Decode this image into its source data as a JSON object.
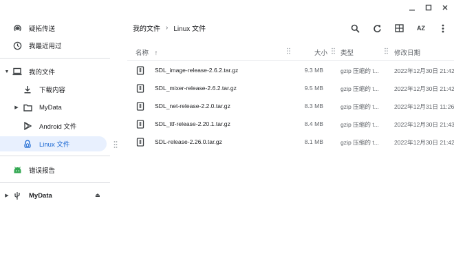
{
  "window": {
    "minimize_icon": "minimize-icon",
    "maximize_icon": "maximize-icon",
    "close_icon": "close-icon"
  },
  "sidebar": {
    "items": [
      {
        "label": "疑拓传送",
        "icon": "nearby-share-icon"
      },
      {
        "label": "我最近用过",
        "icon": "recent-clock-icon"
      },
      {
        "label": "我的文件",
        "icon": "laptop-icon",
        "expanded": true
      },
      {
        "label": "下载内容",
        "icon": "download-icon"
      },
      {
        "label": "MyData",
        "icon": "folder-icon"
      },
      {
        "label": "Android 文件",
        "icon": "play-store-icon"
      },
      {
        "label": "Linux 文件",
        "icon": "linux-penguin-icon",
        "selected": true
      },
      {
        "label": "错误报告",
        "icon": "android-icon"
      },
      {
        "label": "MyData",
        "icon": "usb-icon"
      }
    ]
  },
  "breadcrumb": {
    "root": "我的文件",
    "current": "Linux 文件"
  },
  "toolbar": {
    "icons": [
      "search-icon",
      "refresh-icon",
      "grid-view-icon",
      "sort-az-icon",
      "more-vert-icon"
    ],
    "sort_label": "AZ"
  },
  "columns": {
    "name": "名称",
    "size": "大小",
    "type": "类型",
    "modified": "修改日期"
  },
  "files": [
    {
      "name": "SDL_image-release-2.6.2.tar.gz",
      "size": "9.3 MB",
      "type": "gzip 压缩的 t...",
      "modified": "2022年12月30日 21:42"
    },
    {
      "name": "SDL_mixer-release-2.6.2.tar.gz",
      "size": "9.5 MB",
      "type": "gzip 压缩的 t...",
      "modified": "2022年12月30日 21:42"
    },
    {
      "name": "SDL_net-release-2.2.0.tar.gz",
      "size": "8.3 MB",
      "type": "gzip 压缩的 t...",
      "modified": "2022年12月31日 11:26"
    },
    {
      "name": "SDL_ttf-release-2.20.1.tar.gz",
      "size": "8.4 MB",
      "type": "gzip 压缩的 t...",
      "modified": "2022年12月30日 21:43"
    },
    {
      "name": "SDL-release-2.26.0.tar.gz",
      "size": "8.1 MB",
      "type": "gzip 压缩的 t...",
      "modified": "2022年12月30日 21:42"
    }
  ],
  "colors": {
    "accent": "#1a73e8",
    "selected_bg": "#e8f0fe",
    "divider": "#dadce0"
  }
}
